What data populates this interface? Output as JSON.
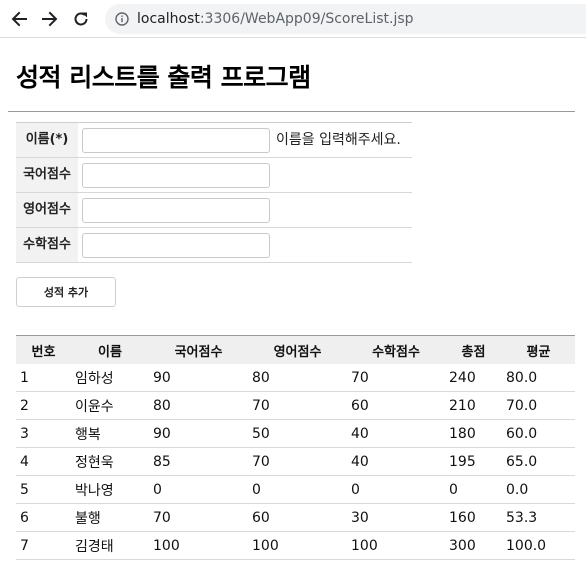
{
  "browser": {
    "url_host": "localhost",
    "url_port": ":3306",
    "url_path": "/WebApp09/ScoreList.jsp"
  },
  "page": {
    "title": "성적 리스트를 출력 프로그램"
  },
  "form": {
    "fields": [
      {
        "label": "이름(*)",
        "value": "",
        "hint": "이름을 입력해주세요."
      },
      {
        "label": "국어점수",
        "value": "",
        "hint": ""
      },
      {
        "label": "영어점수",
        "value": "",
        "hint": ""
      },
      {
        "label": "수학점수",
        "value": "",
        "hint": ""
      }
    ],
    "submit_label": "성적 추가"
  },
  "table": {
    "headers": [
      "번호",
      "이름",
      "국어점수",
      "영어점수",
      "수학점수",
      "총점",
      "평균"
    ],
    "rows": [
      [
        "1",
        "임하성",
        "90",
        "80",
        "70",
        "240",
        "80.0"
      ],
      [
        "2",
        "이윤수",
        "80",
        "70",
        "60",
        "210",
        "70.0"
      ],
      [
        "3",
        "행복",
        "90",
        "50",
        "40",
        "180",
        "60.0"
      ],
      [
        "4",
        "정현욱",
        "85",
        "70",
        "40",
        "195",
        "65.0"
      ],
      [
        "5",
        "박나영",
        "0",
        "0",
        "0",
        "0",
        "0.0"
      ],
      [
        "6",
        "불행",
        "70",
        "60",
        "30",
        "160",
        "53.3"
      ],
      [
        "7",
        "김경태",
        "100",
        "100",
        "100",
        "300",
        "100.0"
      ]
    ]
  }
}
